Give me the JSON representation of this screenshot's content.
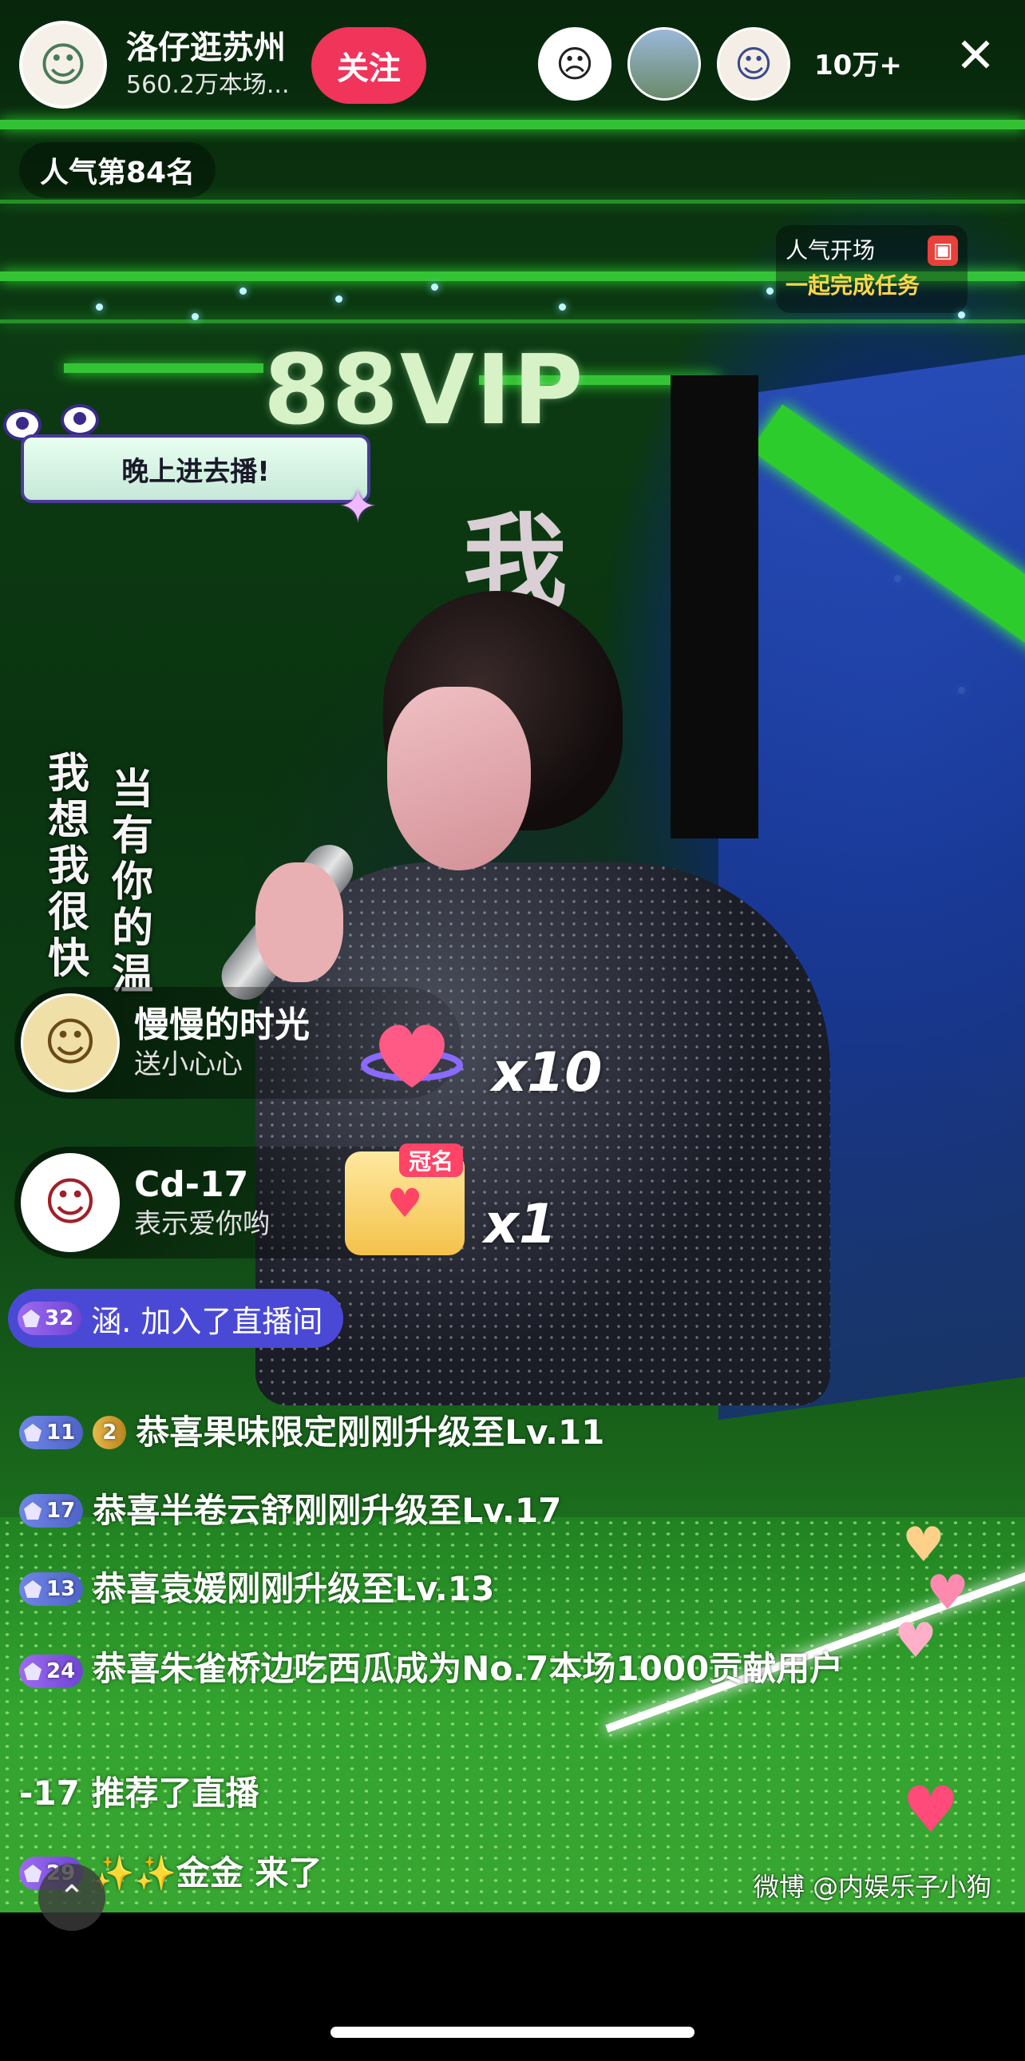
{
  "anchor": {
    "name": "洛仔逛苏州",
    "views": "560.2万本场...",
    "follow_label": "关注"
  },
  "viewers": {
    "count": "10万+",
    "close_label": "✕"
  },
  "rank": {
    "label": "人气第84名"
  },
  "task": {
    "title": "人气开场",
    "subtitle": "一起完成任务"
  },
  "video": {
    "sign": "88VIP",
    "big_char": "我",
    "lyric_left": "我想我很快",
    "lyric_right": "当有你的温"
  },
  "bubble": {
    "text": "晚上进去播!"
  },
  "gifts": [
    {
      "user": "慢慢的时光",
      "action": "送小心心",
      "count": "x10"
    },
    {
      "user": "Cd-17",
      "action": "表示爱你哟",
      "count": "x1",
      "tag": "冠名"
    }
  ],
  "chat": {
    "join": {
      "level": "32",
      "text": "涵. 加入了直播间"
    },
    "lines": [
      {
        "level": "11",
        "badge": "2",
        "text": "恭喜果味限定刚刚升级至Lv.11"
      },
      {
        "level": "17",
        "text": "恭喜半卷云舒刚刚升级至Lv.17"
      },
      {
        "level": "13",
        "text": "恭喜袁媛刚刚升级至Lv.13"
      },
      {
        "level": "24",
        "text": "恭喜朱雀桥边吃西瓜成为No.7本场1000贡献用户"
      },
      {
        "text": "-17 推荐了直播"
      },
      {
        "level": "29",
        "text": "✨✨金金 来了"
      }
    ]
  },
  "watermark": "微博 @内娱乐子小狗",
  "colors": {
    "follow": "#f0345a",
    "join_pill": "#4a49d6",
    "task_sub": "#ffd64a"
  }
}
